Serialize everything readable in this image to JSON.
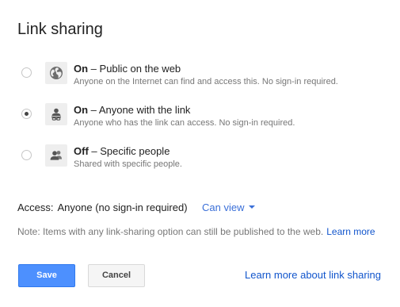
{
  "dialog": {
    "title": "Link sharing"
  },
  "options": [
    {
      "state": "On",
      "separator": " – ",
      "label": "Public on the web",
      "description": "Anyone on the Internet can find and access this. No sign-in required.",
      "icon": "globe-icon",
      "selected": false
    },
    {
      "state": "On",
      "separator": " – ",
      "label": "Anyone with the link",
      "description": "Anyone who has the link can access. No sign-in required.",
      "icon": "person-link-icon",
      "selected": true
    },
    {
      "state": "Off",
      "separator": " – ",
      "label": "Specific people",
      "description": "Shared with specific people.",
      "icon": "people-icon",
      "selected": false
    }
  ],
  "access": {
    "label": "Access:",
    "value": "Anyone (no sign-in required)",
    "permission": "Can view"
  },
  "note": {
    "text": "Note: Items with any link-sharing option can still be published to the web.",
    "link": "Learn more"
  },
  "buttons": {
    "save": "Save",
    "cancel": "Cancel"
  },
  "footer_link": "Learn more about link sharing",
  "colors": {
    "primary_button": "#4d90fe",
    "link": "#1155cc",
    "dropdown_link": "#3a6fd8",
    "secondary_text": "#777777"
  }
}
